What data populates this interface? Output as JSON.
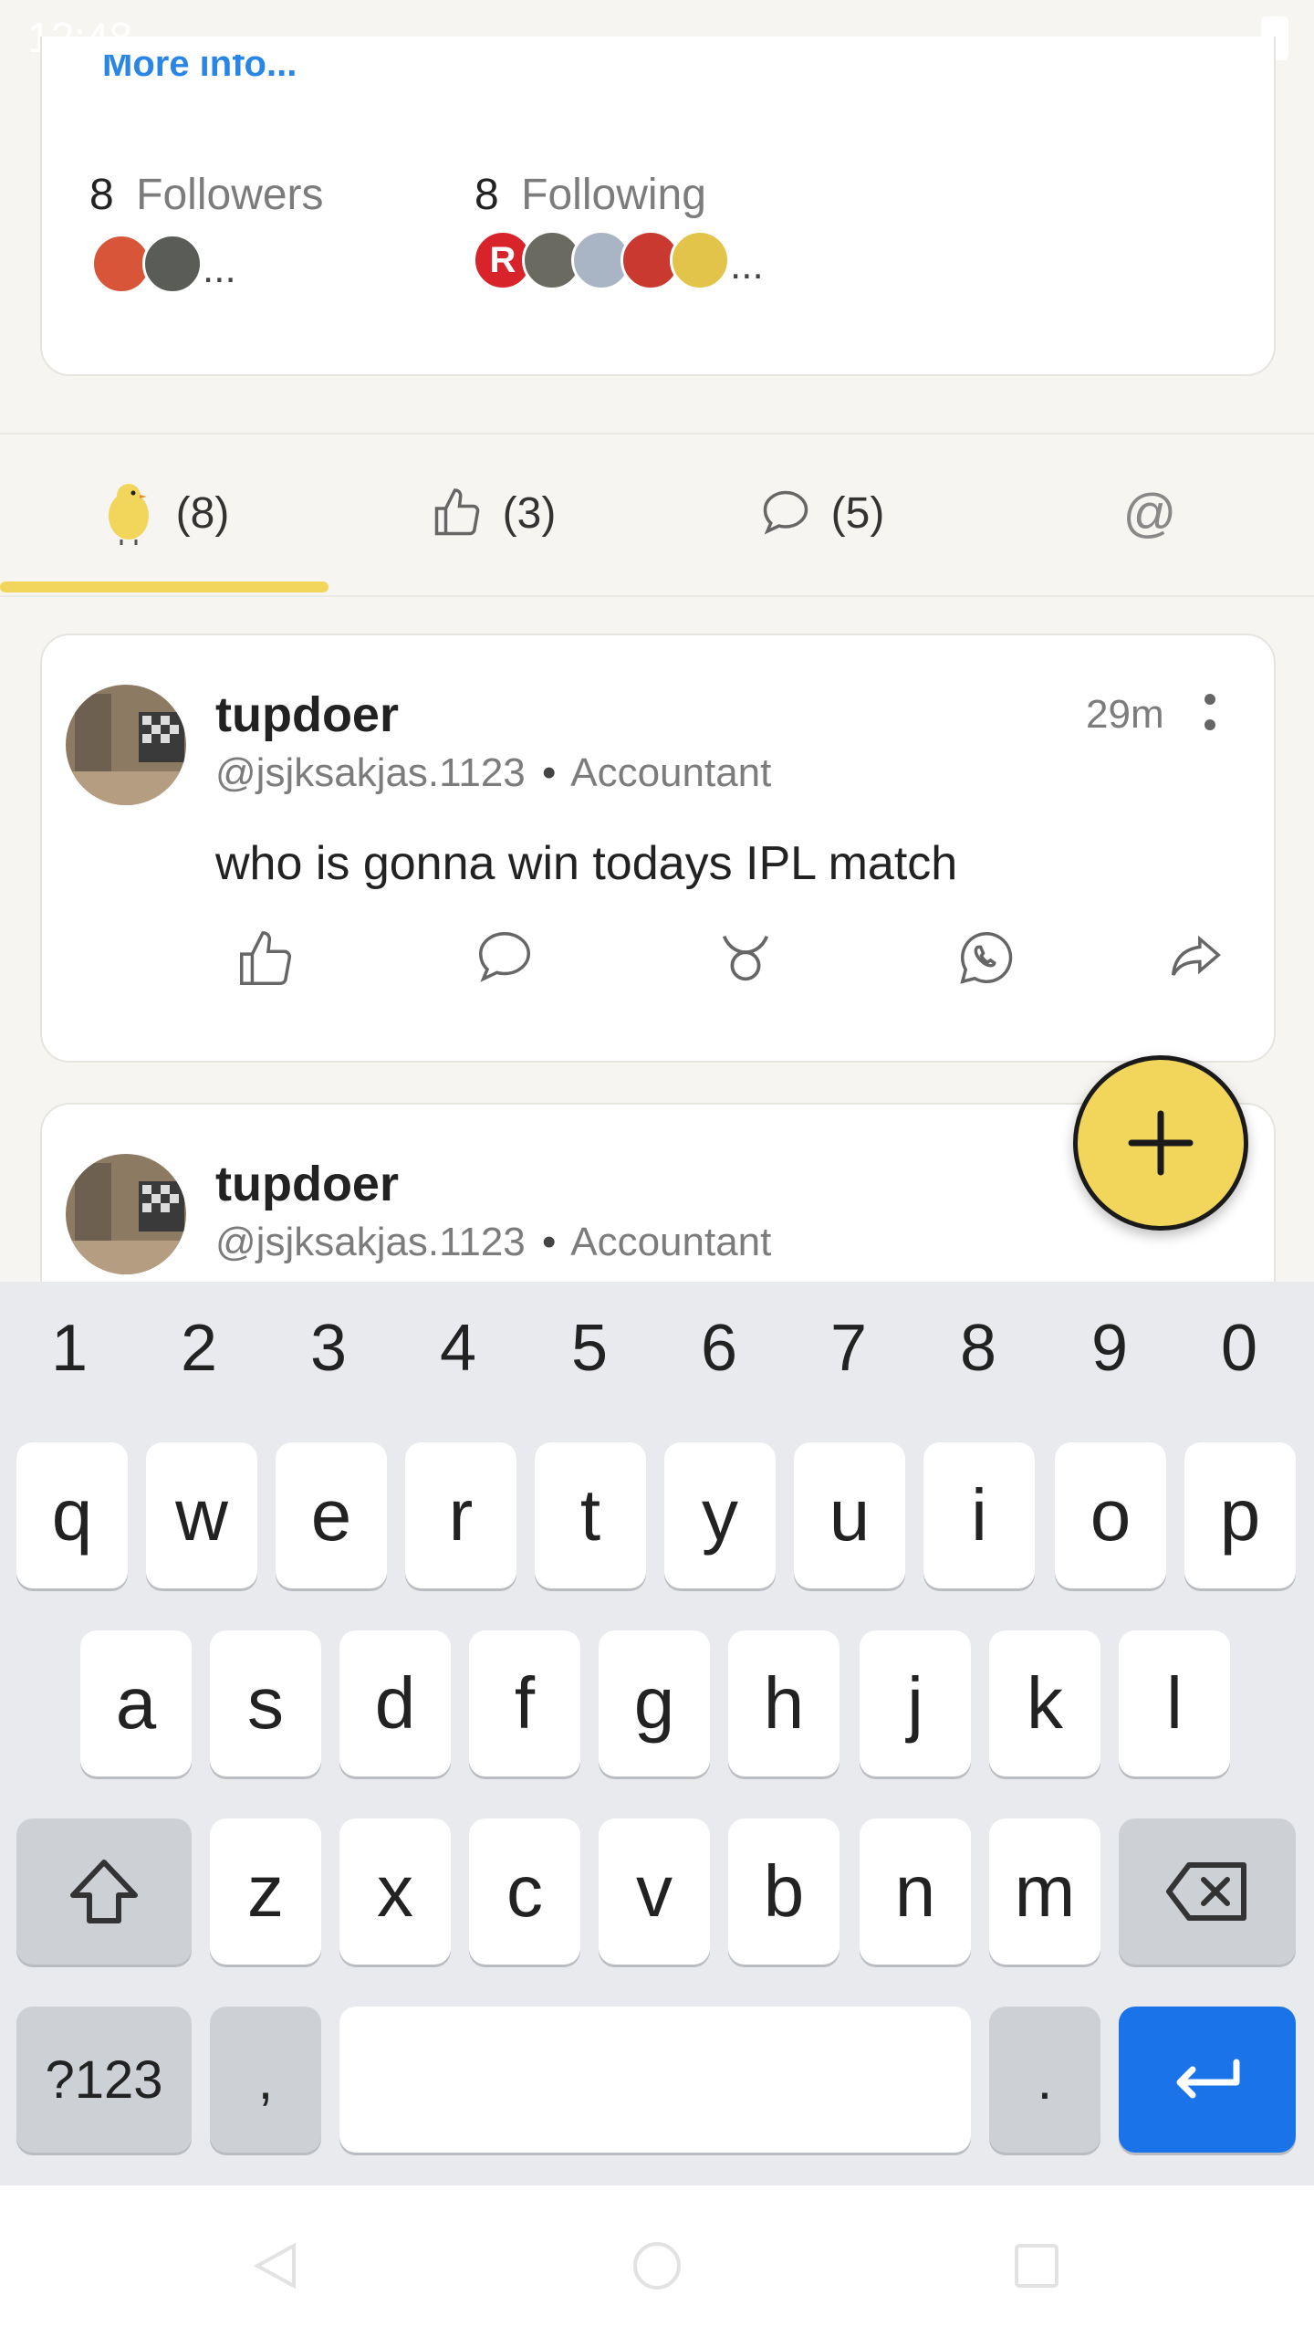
{
  "status_bar": {
    "time": "12:48"
  },
  "profile": {
    "more_info": "More info...",
    "followers_count": "8",
    "followers_label": "Followers",
    "following_count": "8",
    "following_label": "Following",
    "ellipsis": "..."
  },
  "tabs": [
    {
      "icon": "chick-icon",
      "count": "(8)",
      "active": true
    },
    {
      "icon": "thumbs-up-icon",
      "count": "(3)"
    },
    {
      "icon": "comment-icon",
      "count": "(5)"
    },
    {
      "icon": "at-icon",
      "label": "@"
    }
  ],
  "posts": [
    {
      "name": "tupdoer",
      "handle": "@jsjksakjas.1123",
      "separator": "•",
      "role": "Accountant",
      "time": "29m",
      "text": "who is gonna win todays IPL match"
    },
    {
      "name": "tupdoer",
      "handle": "@jsjksakjas.1123",
      "separator": "•",
      "role": "Accountant"
    }
  ],
  "fab": {
    "icon": "plus-icon"
  },
  "keyboard": {
    "numbers": [
      "1",
      "2",
      "3",
      "4",
      "5",
      "6",
      "7",
      "8",
      "9",
      "0"
    ],
    "row1": [
      "q",
      "w",
      "e",
      "r",
      "t",
      "y",
      "u",
      "i",
      "o",
      "p"
    ],
    "row2": [
      "a",
      "s",
      "d",
      "f",
      "g",
      "h",
      "j",
      "k",
      "l"
    ],
    "row3": [
      "z",
      "x",
      "c",
      "v",
      "b",
      "n",
      "m"
    ],
    "symbols_key": "?123",
    "comma_key": ",",
    "period_key": "."
  },
  "colors": {
    "accent_yellow": "#f2d65c",
    "link_blue": "#2a86e6",
    "enter_blue": "#1a73e8"
  }
}
